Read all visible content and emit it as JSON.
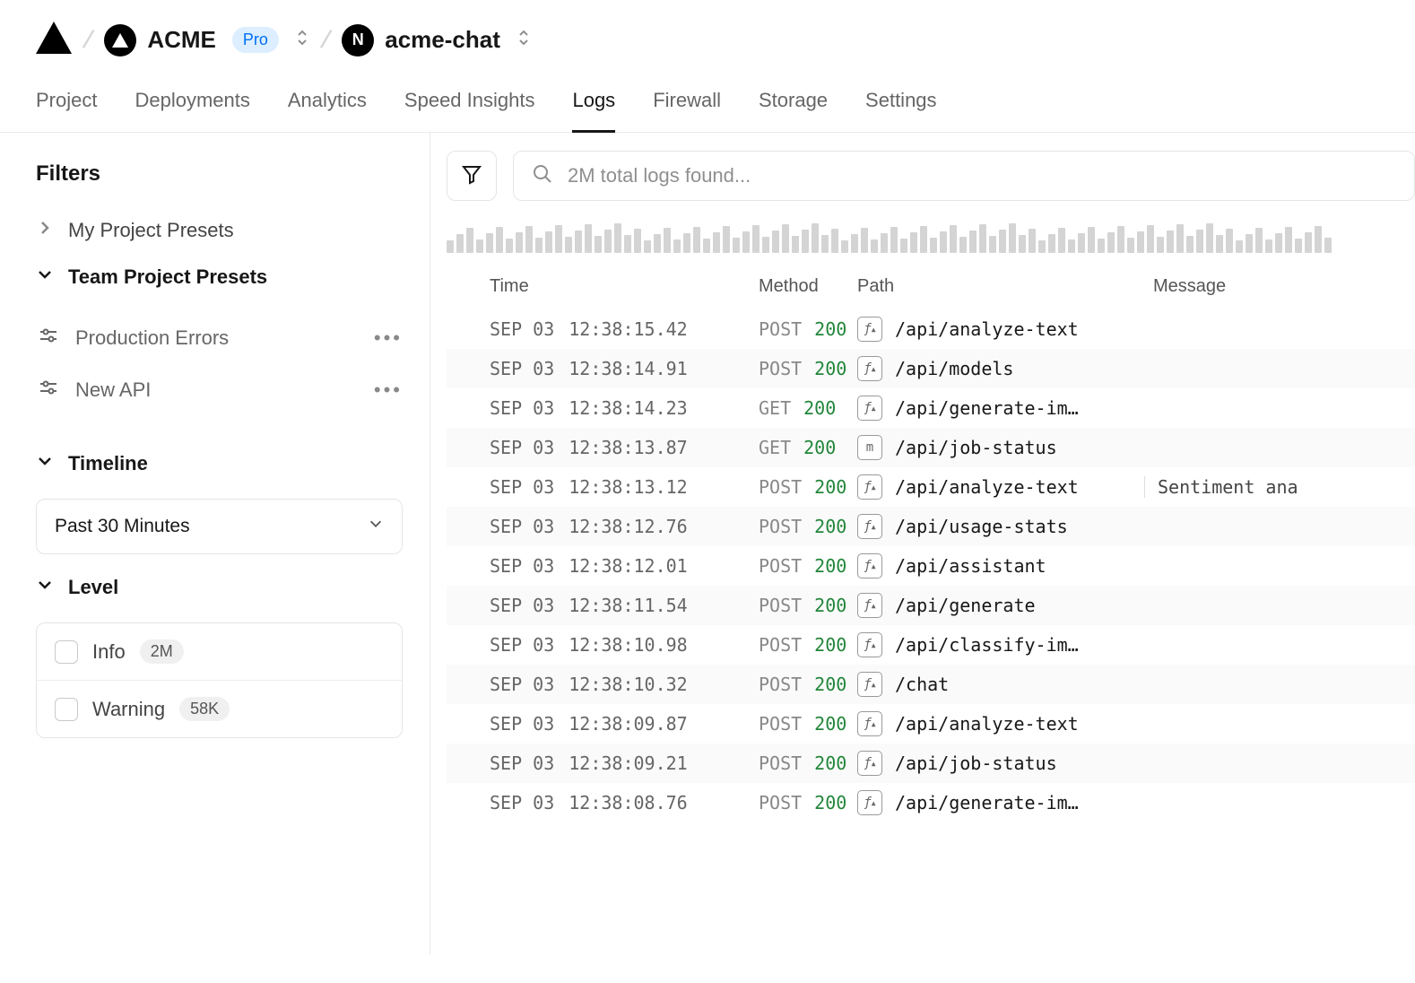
{
  "breadcrumb": {
    "team_name": "ACME",
    "badge": "Pro",
    "project_name": "acme-chat"
  },
  "nav": {
    "tabs": [
      "Project",
      "Deployments",
      "Analytics",
      "Speed Insights",
      "Logs",
      "Firewall",
      "Storage",
      "Settings"
    ],
    "active": "Logs"
  },
  "sidebar": {
    "filters_title": "Filters",
    "my_presets_label": "My Project Presets",
    "team_presets_label": "Team Project Presets",
    "presets": [
      {
        "label": "Production Errors"
      },
      {
        "label": "New API"
      }
    ],
    "timeline": {
      "label": "Timeline",
      "value": "Past 30 Minutes"
    },
    "level": {
      "label": "Level",
      "items": [
        {
          "name": "Info",
          "count": "2M"
        },
        {
          "name": "Warning",
          "count": "58K"
        }
      ]
    }
  },
  "search": {
    "placeholder": "2M total logs found..."
  },
  "table": {
    "headers": {
      "time": "Time",
      "method": "Method",
      "path": "Path",
      "message": "Message"
    },
    "rows": [
      {
        "date": "SEP 03",
        "time": "12:38:15.42",
        "method": "POST",
        "status": "200",
        "icon": "fn",
        "path": "/api/analyze-text",
        "message": ""
      },
      {
        "date": "SEP 03",
        "time": "12:38:14.91",
        "method": "POST",
        "status": "200",
        "icon": "fn",
        "path": "/api/models",
        "message": ""
      },
      {
        "date": "SEP 03",
        "time": "12:38:14.23",
        "method": "GET",
        "status": "200",
        "icon": "fn",
        "path": "/api/generate-im…",
        "message": ""
      },
      {
        "date": "SEP 03",
        "time": "12:38:13.87",
        "method": "GET",
        "status": "200",
        "icon": "m",
        "path": "/api/job-status",
        "message": ""
      },
      {
        "date": "SEP 03",
        "time": "12:38:13.12",
        "method": "POST",
        "status": "200",
        "icon": "fn",
        "path": "/api/analyze-text",
        "message": "Sentiment ana"
      },
      {
        "date": "SEP 03",
        "time": "12:38:12.76",
        "method": "POST",
        "status": "200",
        "icon": "fn",
        "path": "/api/usage-stats",
        "message": ""
      },
      {
        "date": "SEP 03",
        "time": "12:38:12.01",
        "method": "POST",
        "status": "200",
        "icon": "fn",
        "path": "/api/assistant",
        "message": ""
      },
      {
        "date": "SEP 03",
        "time": "12:38:11.54",
        "method": "POST",
        "status": "200",
        "icon": "fn",
        "path": "/api/generate",
        "message": ""
      },
      {
        "date": "SEP 03",
        "time": "12:38:10.98",
        "method": "POST",
        "status": "200",
        "icon": "fn",
        "path": "/api/classify-im…",
        "message": ""
      },
      {
        "date": "SEP 03",
        "time": "12:38:10.32",
        "method": "POST",
        "status": "200",
        "icon": "fn",
        "path": "/chat",
        "message": ""
      },
      {
        "date": "SEP 03",
        "time": "12:38:09.87",
        "method": "POST",
        "status": "200",
        "icon": "fn",
        "path": "/api/analyze-text",
        "message": ""
      },
      {
        "date": "SEP 03",
        "time": "12:38:09.21",
        "method": "POST",
        "status": "200",
        "icon": "fn",
        "path": "/api/job-status",
        "message": ""
      },
      {
        "date": "SEP 03",
        "time": "12:38:08.76",
        "method": "POST",
        "status": "200",
        "icon": "fn",
        "path": "/api/generate-im…",
        "message": ""
      }
    ]
  },
  "colors": {
    "status_ok": "#22863a",
    "accent": "#0070f3"
  }
}
